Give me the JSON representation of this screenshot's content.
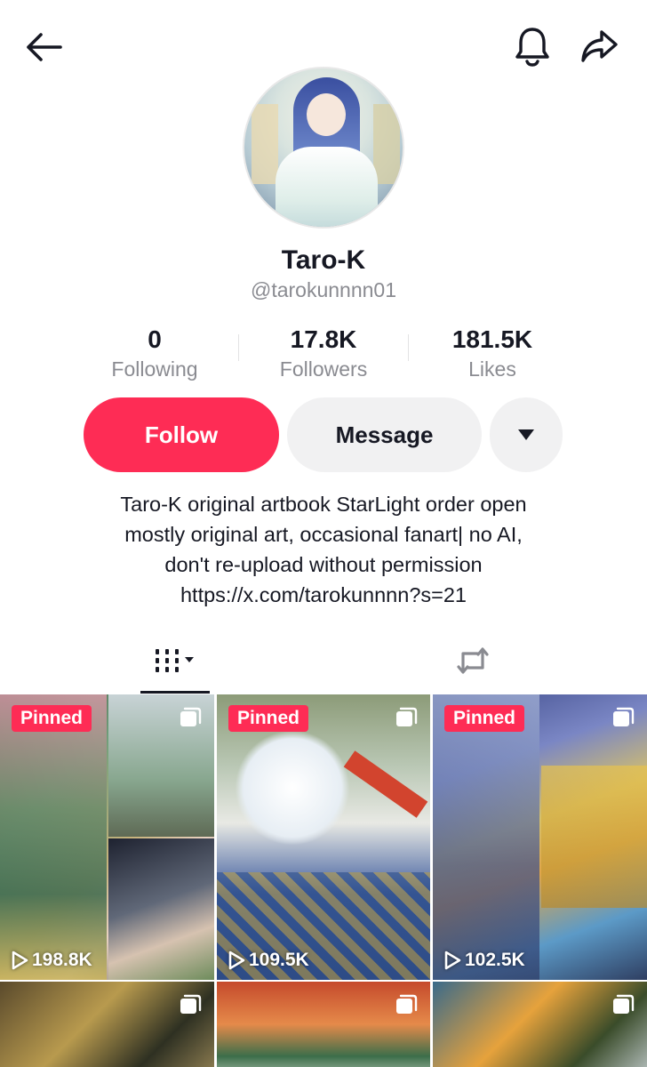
{
  "profile": {
    "name": "Taro-K",
    "handle": "@tarokunnnn01"
  },
  "stats": {
    "following": {
      "value": "0",
      "label": "Following"
    },
    "followers": {
      "value": "17.8K",
      "label": "Followers"
    },
    "likes": {
      "value": "181.5K",
      "label": "Likes"
    }
  },
  "actions": {
    "follow_label": "Follow",
    "message_label": "Message"
  },
  "bio": {
    "lines": [
      "Taro-K original artbook StarLight order open",
      "mostly original art, occasional fanart| no AI,",
      "don't re-upload without permission",
      "https://x.com/tarokunnnn?s=21"
    ]
  },
  "colors": {
    "accent": "#fe2c55",
    "button_gray": "#f1f1f2",
    "secondary_text": "#8a8b91"
  },
  "icons": {
    "back": "arrow-left-icon",
    "notifications": "bell-icon",
    "share": "share-arrow-icon",
    "more": "caret-down-icon",
    "videos_tab": "grid-icon",
    "reposts_tab": "repost-icon",
    "views": "play-icon",
    "multi_photo": "photo-stack-icon"
  },
  "videos": [
    {
      "pinned_label": "Pinned",
      "views": "198.8K"
    },
    {
      "pinned_label": "Pinned",
      "views": "109.5K"
    },
    {
      "pinned_label": "Pinned",
      "views": "102.5K"
    },
    {
      "pinned_label": "",
      "views": ""
    },
    {
      "pinned_label": "",
      "views": ""
    },
    {
      "pinned_label": "",
      "views": ""
    }
  ]
}
